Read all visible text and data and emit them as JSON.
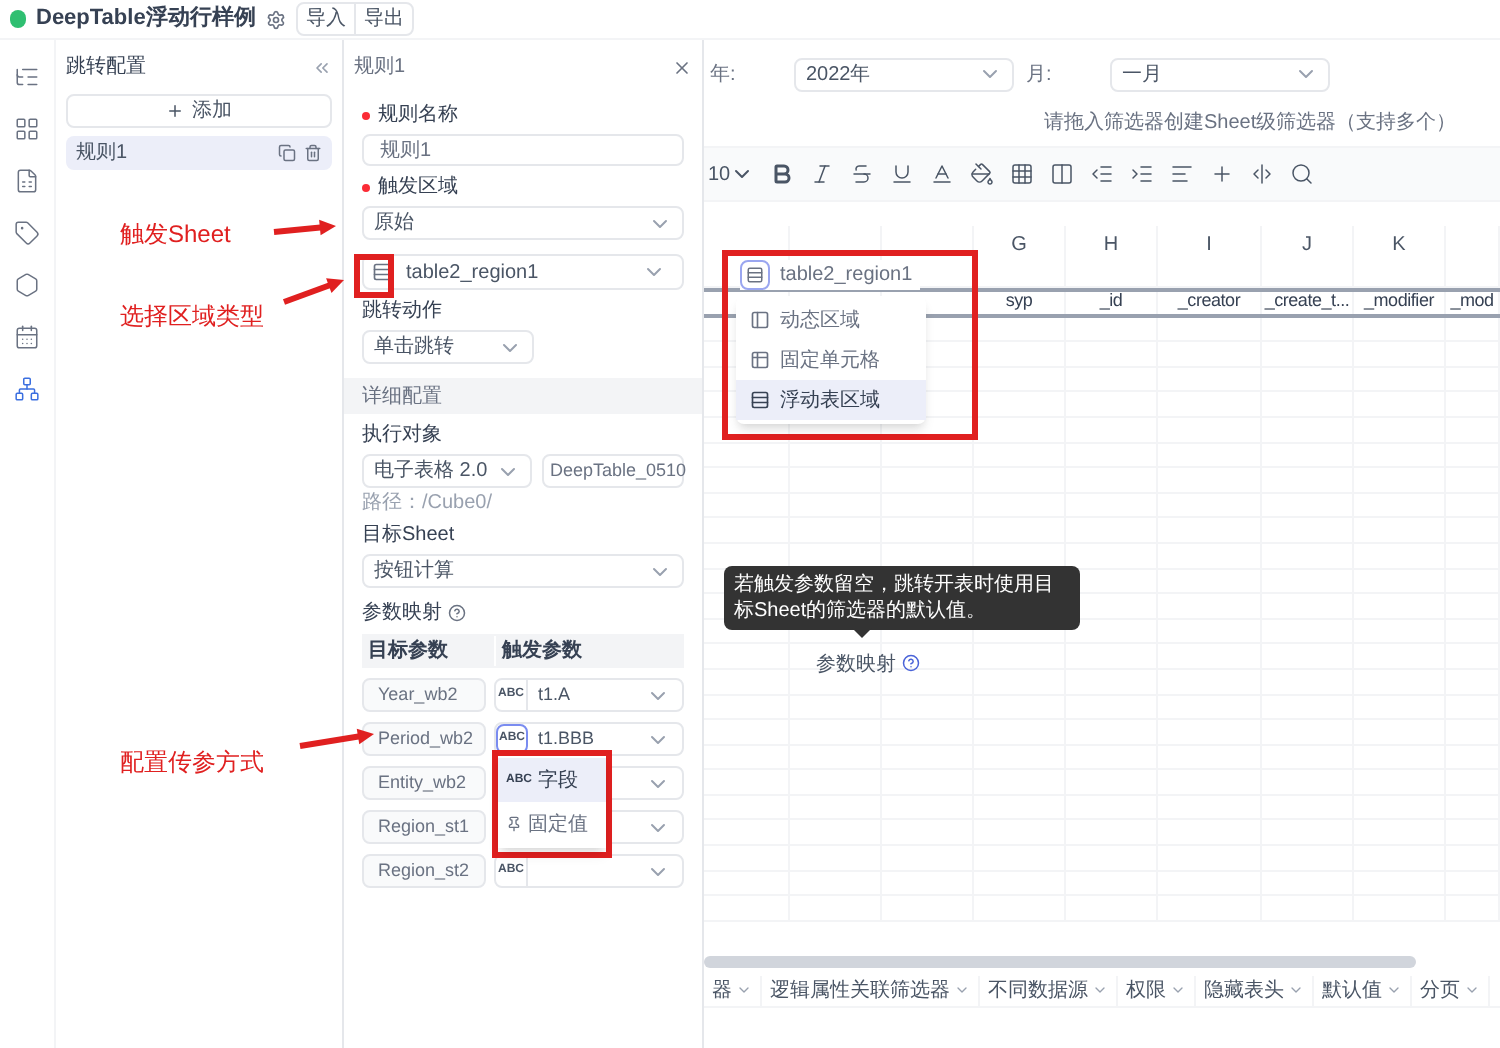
{
  "app_bar": {
    "title": "DeepTable浮动行样例",
    "buttons": [
      "导入",
      "导出"
    ]
  },
  "nav_rail": {
    "items": [
      {
        "kind": "tree",
        "selected": false
      },
      {
        "kind": "grid",
        "selected": false
      },
      {
        "kind": "sheet",
        "selected": false
      },
      {
        "kind": "tag",
        "selected": false
      },
      {
        "kind": "hex",
        "selected": false
      },
      {
        "kind": "calendar",
        "selected": false
      },
      {
        "kind": "network",
        "selected": true
      }
    ]
  },
  "jump_config": {
    "title": "跳转配置",
    "add_button": "添加",
    "rules": [
      {
        "label": "规则1",
        "selected": true
      }
    ]
  },
  "rule_panel": {
    "title": "规则1",
    "rule_name": {
      "label": "规则名称",
      "required": true,
      "value": "规则1"
    },
    "trigger_area": {
      "label": "触发区域",
      "required": true,
      "sheet": "原始",
      "region": "table2_region1"
    },
    "jump_action": {
      "label": "跳转动作",
      "value": "单击跳转"
    },
    "details": {
      "title": "详细配置",
      "target_label": "执行对象",
      "target_type": "电子表格 2.0",
      "target_file": "DeepTable_0510",
      "path": "路径：/Cube0/",
      "sheet_label": "目标Sheet",
      "sheet": "按钮计算",
      "mapping_label": "参数映射",
      "columns": [
        "目标参数",
        "触发参数"
      ],
      "rows": [
        {
          "target": "Year_wb2",
          "type_label": "ABC",
          "source": "t1.A",
          "focused": false
        },
        {
          "target": "Period_wb2",
          "type_label": "ABC",
          "source": "t1.BBB",
          "focused": true
        },
        {
          "target": "Entity_wb2"
        },
        {
          "target": "Region_st1"
        },
        {
          "target": "Region_st2",
          "type_label": "ABC",
          "focused": false
        }
      ]
    }
  },
  "sheet": {
    "filters": [
      {
        "label": "年:",
        "value": "2022年"
      },
      {
        "label": "月:",
        "value": "一月"
      }
    ],
    "filter_hint": "请拖入筛选器创建Sheet级筛选器（支持多个）",
    "font_size": "10",
    "column_letters": [
      "G",
      "H",
      "I",
      "J",
      "K"
    ],
    "header_cells": [
      "syp",
      "_id",
      "_creator",
      "_create_t...",
      "_modifier",
      "_mod"
    ],
    "tabs": [
      {
        "label": "器"
      },
      {
        "label": "逻辑属性关联筛选器"
      },
      {
        "label": "不同数据源"
      },
      {
        "label": "权限"
      },
      {
        "label": "隐藏表头"
      },
      {
        "label": "默认值"
      },
      {
        "label": "分页"
      }
    ]
  },
  "region_menu": {
    "value": "table2_region1",
    "options": [
      {
        "label": "动态区域",
        "kind": "dynamic",
        "selected": false
      },
      {
        "label": "固定单元格",
        "kind": "fixed",
        "selected": false
      },
      {
        "label": "浮动表区域",
        "kind": "float",
        "selected": true
      }
    ]
  },
  "param_menu": {
    "options": [
      {
        "label": "字段",
        "kind": "field",
        "icon_text": "ABC",
        "selected": true
      },
      {
        "label": "固定值",
        "kind": "fixed",
        "selected": false
      }
    ]
  },
  "tooltip": {
    "text": "若触发参数留空，跳转开表时使用目标Sheet的筛选器的默认值。"
  },
  "drag_ghost": {
    "label": "参数映射"
  },
  "annotations": [
    {
      "text": "触发Sheet"
    },
    {
      "text": "选择区域类型"
    },
    {
      "text": "配置传参方式"
    }
  ]
}
